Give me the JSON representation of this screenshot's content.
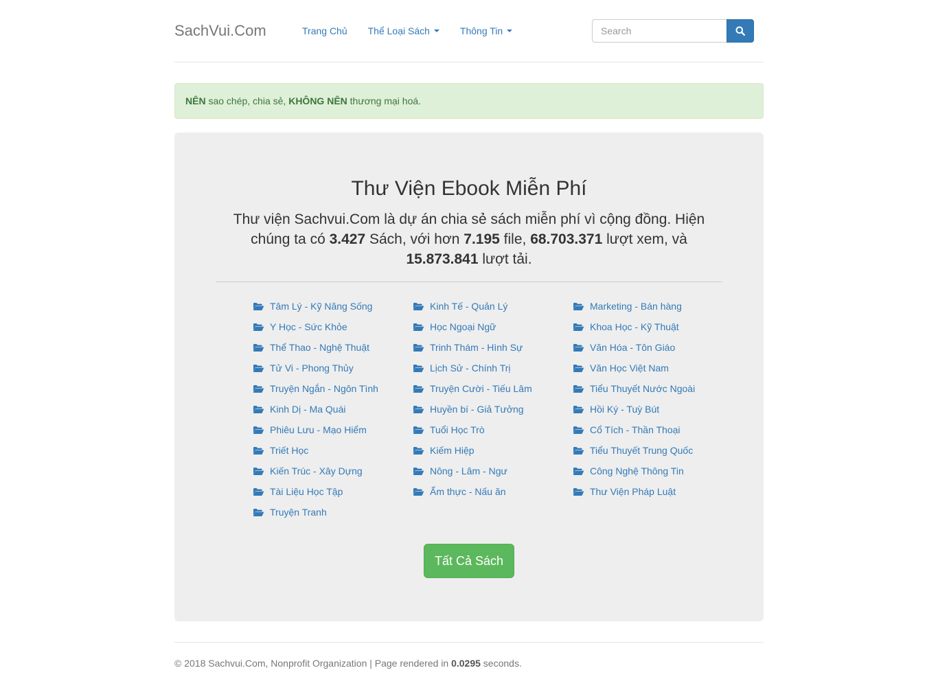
{
  "brand": "SachVui.Com",
  "nav": {
    "home": "Trang Chủ",
    "categories": "Thể Loại Sách",
    "info": "Thông Tin"
  },
  "search": {
    "placeholder": "Search",
    "icon": "search-icon"
  },
  "alert": {
    "bold1": "NÊN",
    "text1": " sao chép, chia sẻ, ",
    "bold2": "KHÔNG NÊN",
    "text2": " thương mại hoá."
  },
  "jumbo": {
    "title": "Thư Viện Ebook Miễn Phí",
    "lead_1": "Thư viện Sachvui.Com là dự án chia sẻ sách miễn phí vì cộng đồng. Hiện chúng ta có ",
    "books": "3.427",
    "lead_2": " Sách, với hơn ",
    "files": "7.195",
    "lead_3": " file, ",
    "views": "68.703.371",
    "lead_4": " lượt xem, và ",
    "downloads": "15.873.841",
    "lead_5": " lượt tải.",
    "button": "Tất Cả Sách"
  },
  "categories": {
    "icon": "folder-open-icon",
    "col1": [
      "Tâm Lý - Kỹ Năng Sống",
      "Y Học - Sức Khỏe",
      "Thể Thao - Nghệ Thuật",
      "Tử Vi - Phong Thủy",
      "Truyện Ngắn - Ngôn Tình",
      "Kinh Dị - Ma Quái",
      "Phiêu Lưu - Mạo Hiểm",
      "Triết Học",
      "Kiến Trúc - Xây Dựng",
      "Tài Liệu Học Tập",
      "Truyện Tranh"
    ],
    "col2": [
      "Kinh Tế - Quản Lý",
      "Học Ngoại Ngữ",
      "Trinh Thám - Hình Sự",
      "Lịch Sử - Chính Trị",
      "Truyện Cười - Tiếu Lâm",
      "Huyền bí - Giả Tưởng",
      "Tuổi Học Trò",
      "Kiếm Hiệp",
      "Nông - Lâm - Ngư",
      "Ẩm thực - Nấu ăn"
    ],
    "col3": [
      "Marketing - Bán hàng",
      "Khoa Học - Kỹ Thuật",
      "Văn Hóa - Tôn Giáo",
      "Văn Học Việt Nam",
      "Tiểu Thuyết Nước Ngoài",
      "Hồi Ký - Tuỳ Bút",
      "Cổ Tích - Thần Thoại",
      "Tiểu Thuyết Trung Quốc",
      "Công Nghệ Thông Tin",
      "Thư Viện Pháp Luật"
    ]
  },
  "footer": {
    "text1": "© 2018 Sachvui.Com, Nonprofit Organization | Page rendered in ",
    "time": "0.0295",
    "text2": " seconds."
  },
  "colors": {
    "link": "#337ab7",
    "success": "#5cb85c",
    "alert_bg": "#dff0d8",
    "alert_text": "#3c763d",
    "jumbo_bg": "#eeeeee"
  }
}
